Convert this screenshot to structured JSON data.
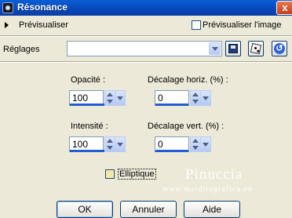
{
  "window": {
    "title": "Résonance",
    "close_label": "x"
  },
  "preview": {
    "label": "Prévisualiser",
    "preview_image_label": "Prévisualiser l'image",
    "preview_image_checked": false
  },
  "settings": {
    "label": "Réglages",
    "value": ""
  },
  "toolbar": {
    "icons": [
      "save-icon",
      "dice-icon",
      "reset-icon"
    ]
  },
  "fields": {
    "opacity": {
      "label": "Opacité :",
      "value": "100"
    },
    "h_offset": {
      "label": "Décalage horiz. (%) :",
      "value": "0"
    },
    "intensity": {
      "label": "Intensité :",
      "value": "100"
    },
    "v_offset": {
      "label": "Décalage vert. (%) :",
      "value": "0"
    }
  },
  "elliptic": {
    "label": "Elliptique",
    "checked": false
  },
  "watermark": {
    "name": "Pinuccia",
    "url": "www.maidiregrafica.eu"
  },
  "buttons": {
    "ok": "OK",
    "cancel": "Annuler",
    "help": "Aide"
  },
  "colors": {
    "titlebar": "#0846b8",
    "dialog_bg": "#ece9d8",
    "accent": "#1f5fd0"
  }
}
